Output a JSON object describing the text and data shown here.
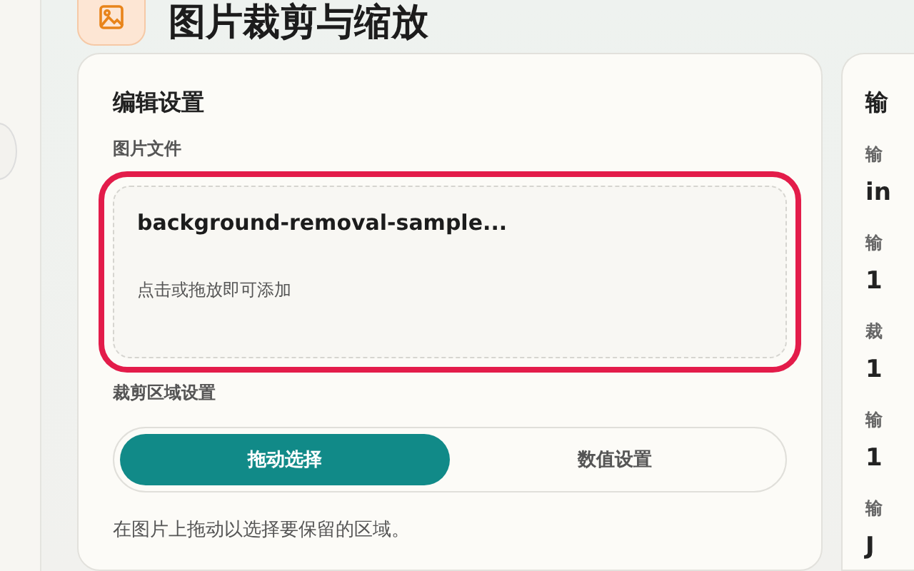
{
  "header": {
    "title": "图片裁剪与缩放"
  },
  "editor": {
    "title": "编辑设置",
    "file_label": "图片文件",
    "file_name": "background-removal-sample...",
    "drop_hint": "点击或拖放即可添加",
    "highlighted": true,
    "crop_label": "裁剪区域设置",
    "modes": [
      {
        "label": "拖动选择",
        "selected": true
      },
      {
        "label": "数值设置",
        "selected": false
      }
    ],
    "help": "在图片上拖动以选择要保留的区域。"
  },
  "output": {
    "title": "输",
    "fields": [
      {
        "label": "输",
        "value": "in"
      },
      {
        "label": "输",
        "value": "1"
      },
      {
        "label": "裁",
        "value": "1"
      },
      {
        "label": "输",
        "value": "1"
      },
      {
        "label": "输",
        "value": "J"
      }
    ]
  }
}
